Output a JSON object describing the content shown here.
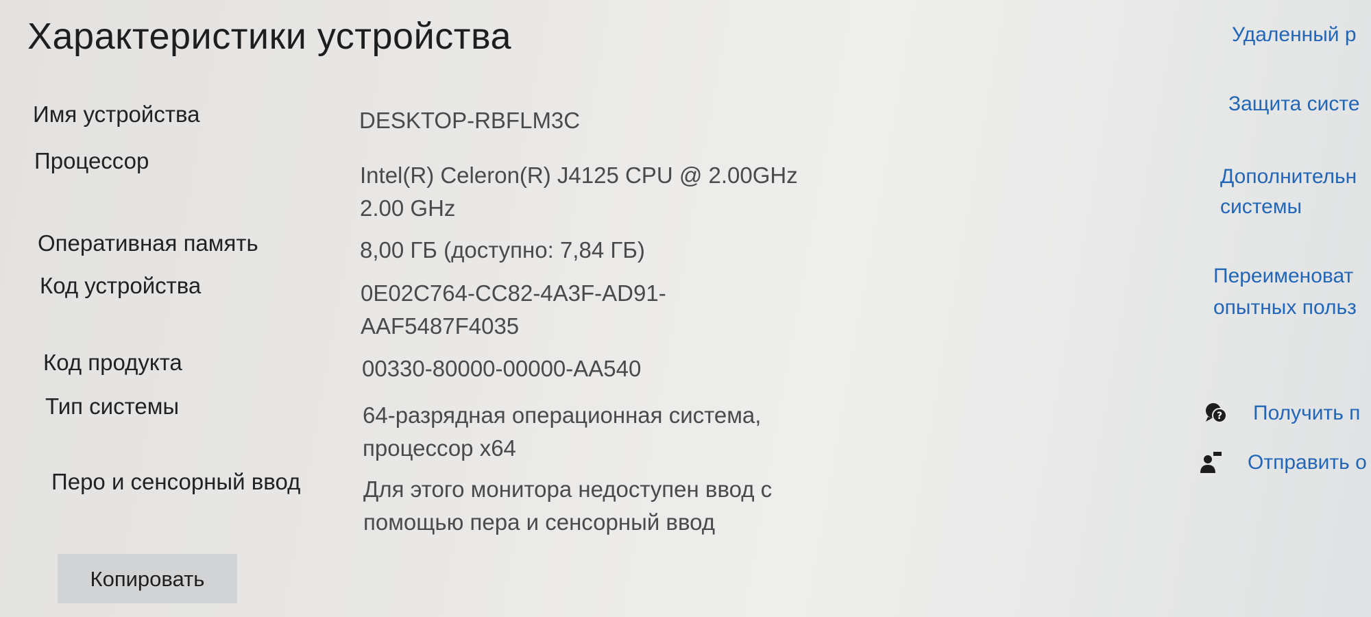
{
  "header": {
    "title": "Характеристики устройства"
  },
  "specs": [
    {
      "label": "Имя устройства",
      "value_lines": [
        "DESKTOP-RBFLM3C"
      ]
    },
    {
      "label": "Процессор",
      "value_lines": [
        "Intel(R) Celeron(R) J4125 CPU @ 2.00GHz",
        "2.00 GHz"
      ]
    },
    {
      "label": "Оперативная память",
      "value_lines": [
        "8,00 ГБ (доступно: 7,84 ГБ)"
      ]
    },
    {
      "label": "Код устройства",
      "value_lines": [
        "0E02C764-CC82-4A3F-AD91-",
        "AAF5487F4035"
      ]
    },
    {
      "label": "Код продукта",
      "value_lines": [
        "00330-80000-00000-AA540"
      ]
    },
    {
      "label": "Тип системы",
      "value_lines": [
        "64-разрядная операционная система,",
        "процессор x64"
      ]
    },
    {
      "label": "Перо и сенсорный ввод",
      "value_lines": [
        "Для этого монитора недоступен ввод с",
        "помощью пера и сенсорный ввод"
      ]
    }
  ],
  "actions": {
    "copy_label": "Копировать"
  },
  "related": {
    "remote": "Удаленный р",
    "protection": "Защита систе",
    "advanced_line1": "Дополнительн",
    "advanced_line2": "системы",
    "rename_line1": "Переименоват",
    "rename_line2": "опытных польз"
  },
  "help": {
    "get_help": "Получить п",
    "feedback": "Отправить о",
    "get_help_icon": "help-chat-icon",
    "feedback_icon": "feedback-person-icon"
  },
  "colors": {
    "link": "#2266b8",
    "button_bg": "#d2d3d5"
  }
}
